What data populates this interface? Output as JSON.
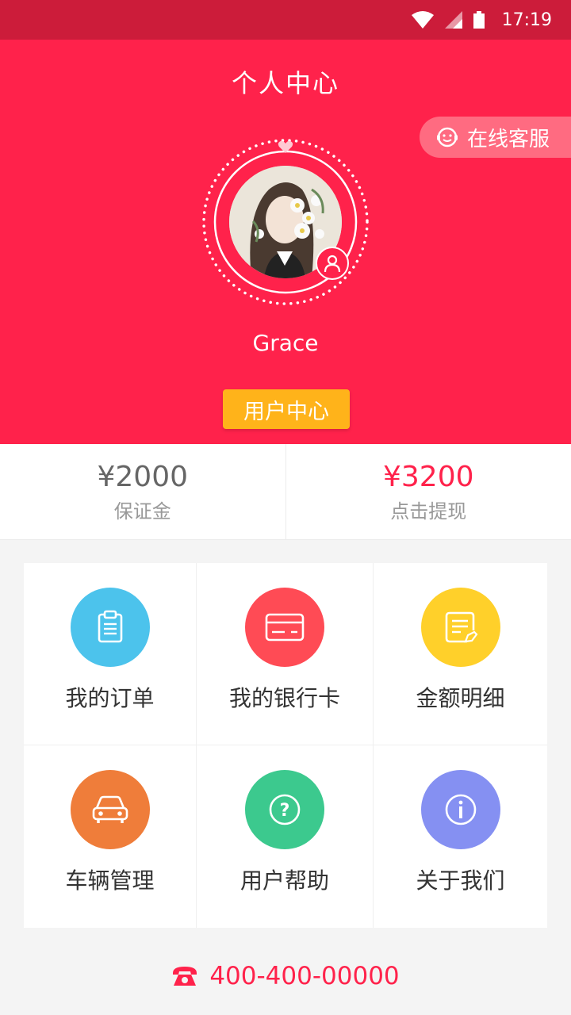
{
  "status_bar": {
    "time": "17:19"
  },
  "header": {
    "title": "个人中心",
    "service_label": "在线客服",
    "username": "Grace",
    "user_center_label": "用户中心"
  },
  "balances": [
    {
      "amount": "¥2000",
      "label": "保证金",
      "color": "#666666"
    },
    {
      "amount": "¥3200",
      "label": "点击提现",
      "color": "#ff224b"
    }
  ],
  "menu": [
    {
      "label": "我的订单",
      "icon": "clipboard-icon",
      "color": "#4cc3ec"
    },
    {
      "label": "我的银行卡",
      "icon": "bank-card-icon",
      "color": "#ff4b55"
    },
    {
      "label": "金额明细",
      "icon": "document-edit-icon",
      "color": "#ffd02a"
    },
    {
      "label": "车辆管理",
      "icon": "car-icon",
      "color": "#ef7d3a"
    },
    {
      "label": "用户帮助",
      "icon": "help-icon",
      "color": "#3cc98e"
    },
    {
      "label": "关于我们",
      "icon": "info-icon",
      "color": "#8590f2"
    }
  ],
  "footer": {
    "phone": "400-400-00000"
  },
  "colors": {
    "brand": "#ff224b",
    "status_bar": "#cc1c3a",
    "accent": "#ffb31a"
  }
}
